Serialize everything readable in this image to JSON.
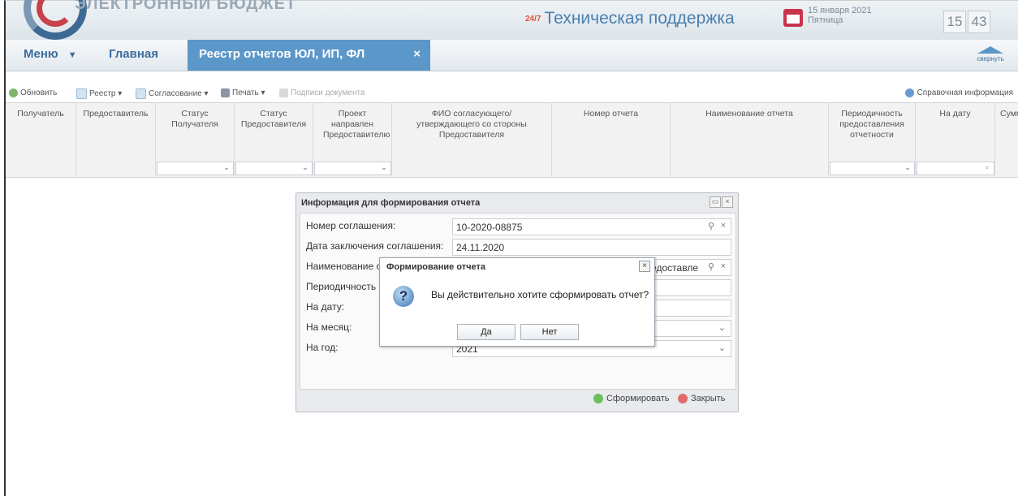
{
  "header": {
    "logo_text": "ЭЛЕКТРОННЫЙ БЮДЖЕТ",
    "support_badge": "24/7",
    "support_text": "Техническая поддержка",
    "date": "15 января 2021",
    "weekday": "Пятница",
    "clock_hours": "15",
    "clock_minutes": "43"
  },
  "nav": {
    "menu_label": "Меню",
    "menu_arrow": "▼",
    "home_label": "Главная",
    "active_tab_label": "Реестр отчетов ЮЛ, ИП, ФЛ",
    "tab_close": "×",
    "collapse_label": "свернуть"
  },
  "toolbar": {
    "refresh": "Обновить",
    "registry": "Реестр ▾",
    "approval": "Согласование ▾",
    "print": "Печать ▾",
    "signatures": "Подписи документа",
    "help": "Справочная информация"
  },
  "grid": {
    "columns": [
      "Получатель",
      "Предоставитель",
      "Статус Получателя",
      "Статус Предоставителя",
      "Проект направлен Предоставителю",
      "ФИО согласующего/утверждающего со стороны Предоставителя",
      "Номер отчета",
      "Наименование отчета",
      "Периодичность предоставления отчетности",
      "На дату",
      "Сумм"
    ]
  },
  "info_window": {
    "title": "Информация для формирования отчета",
    "rows": [
      {
        "label": "Номер соглашения:",
        "value": "10-2020-08875"
      },
      {
        "label": "Дата заключения соглашения:",
        "value": "24.11.2020"
      },
      {
        "label": "Наименование от",
        "value": "едоставле"
      },
      {
        "label": "Периодичность о",
        "value": ""
      },
      {
        "label": "На дату:",
        "value": ""
      },
      {
        "label": "На месяц:",
        "value": ""
      },
      {
        "label": "На год:",
        "value": "2021"
      }
    ],
    "btn_generate": "Сформировать",
    "btn_close": "Закрыть"
  },
  "dialog": {
    "title": "Формирование отчета",
    "message": "Вы действительно хотите сформировать отчет?",
    "yes": "Да",
    "no": "Нет",
    "close": "×"
  }
}
